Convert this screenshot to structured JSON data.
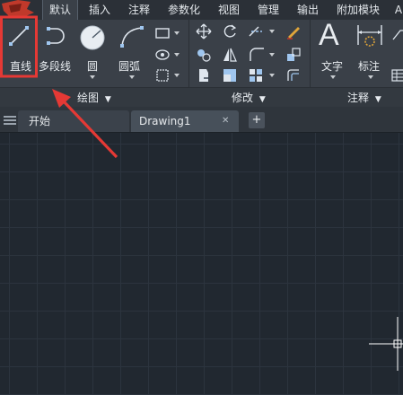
{
  "menubar": {
    "tabs": [
      "默认",
      "插入",
      "注释",
      "参数化",
      "视图",
      "管理",
      "输出",
      "附加模块",
      "A"
    ]
  },
  "ribbon": {
    "draw_tools": {
      "line": "直线",
      "polyline": "多段线",
      "circle": "圆",
      "arc": "圆弧"
    },
    "annotation_tools": {
      "text": "文字",
      "dimension": "标注"
    },
    "panels": {
      "draw": "绘图",
      "modify": "修改",
      "annotation": "注释"
    }
  },
  "filetabs": {
    "start": "开始",
    "drawing": "Drawing1",
    "close": "✕",
    "new": "+"
  },
  "colors": {
    "highlight": "#e53935",
    "background": "#212830",
    "ribbon": "#3a4048"
  },
  "icons": [
    "app-logo-icon",
    "line-icon",
    "polyline-icon",
    "circle-icon",
    "arc-icon",
    "text-icon",
    "dimension-icon",
    "crosshair-icon"
  ]
}
